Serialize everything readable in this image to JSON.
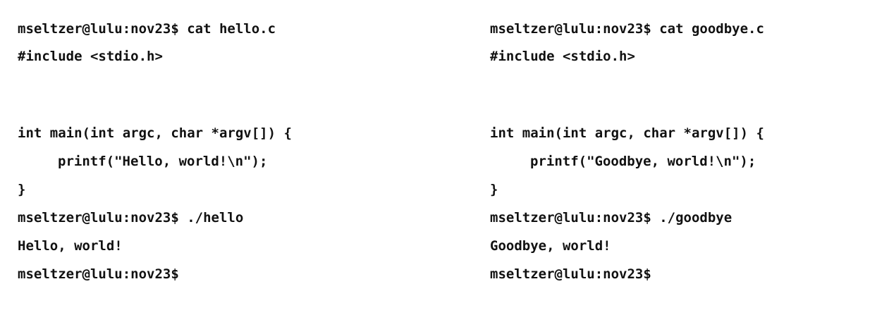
{
  "left_terminal": {
    "prompt_cat": "mseltzer@lulu:nov23$ cat hello.c",
    "include": "#include <stdio.h>",
    "main_decl": "int main(int argc, char *argv[]) {",
    "printf_line": "printf(\"Hello, world!\\n\");",
    "closing_brace": "}",
    "prompt_run": "mseltzer@lulu:nov23$ ./hello",
    "output": "Hello, world!",
    "prompt_final": "mseltzer@lulu:nov23$"
  },
  "right_terminal": {
    "prompt_cat": "mseltzer@lulu:nov23$ cat goodbye.c",
    "include": "#include <stdio.h>",
    "main_decl": "int main(int argc, char *argv[]) {",
    "printf_line": "printf(\"Goodbye, world!\\n\");",
    "closing_brace": "}",
    "prompt_run": "mseltzer@lulu:nov23$ ./goodbye",
    "output": "Goodbye, world!",
    "prompt_final": "mseltzer@lulu:nov23$"
  }
}
